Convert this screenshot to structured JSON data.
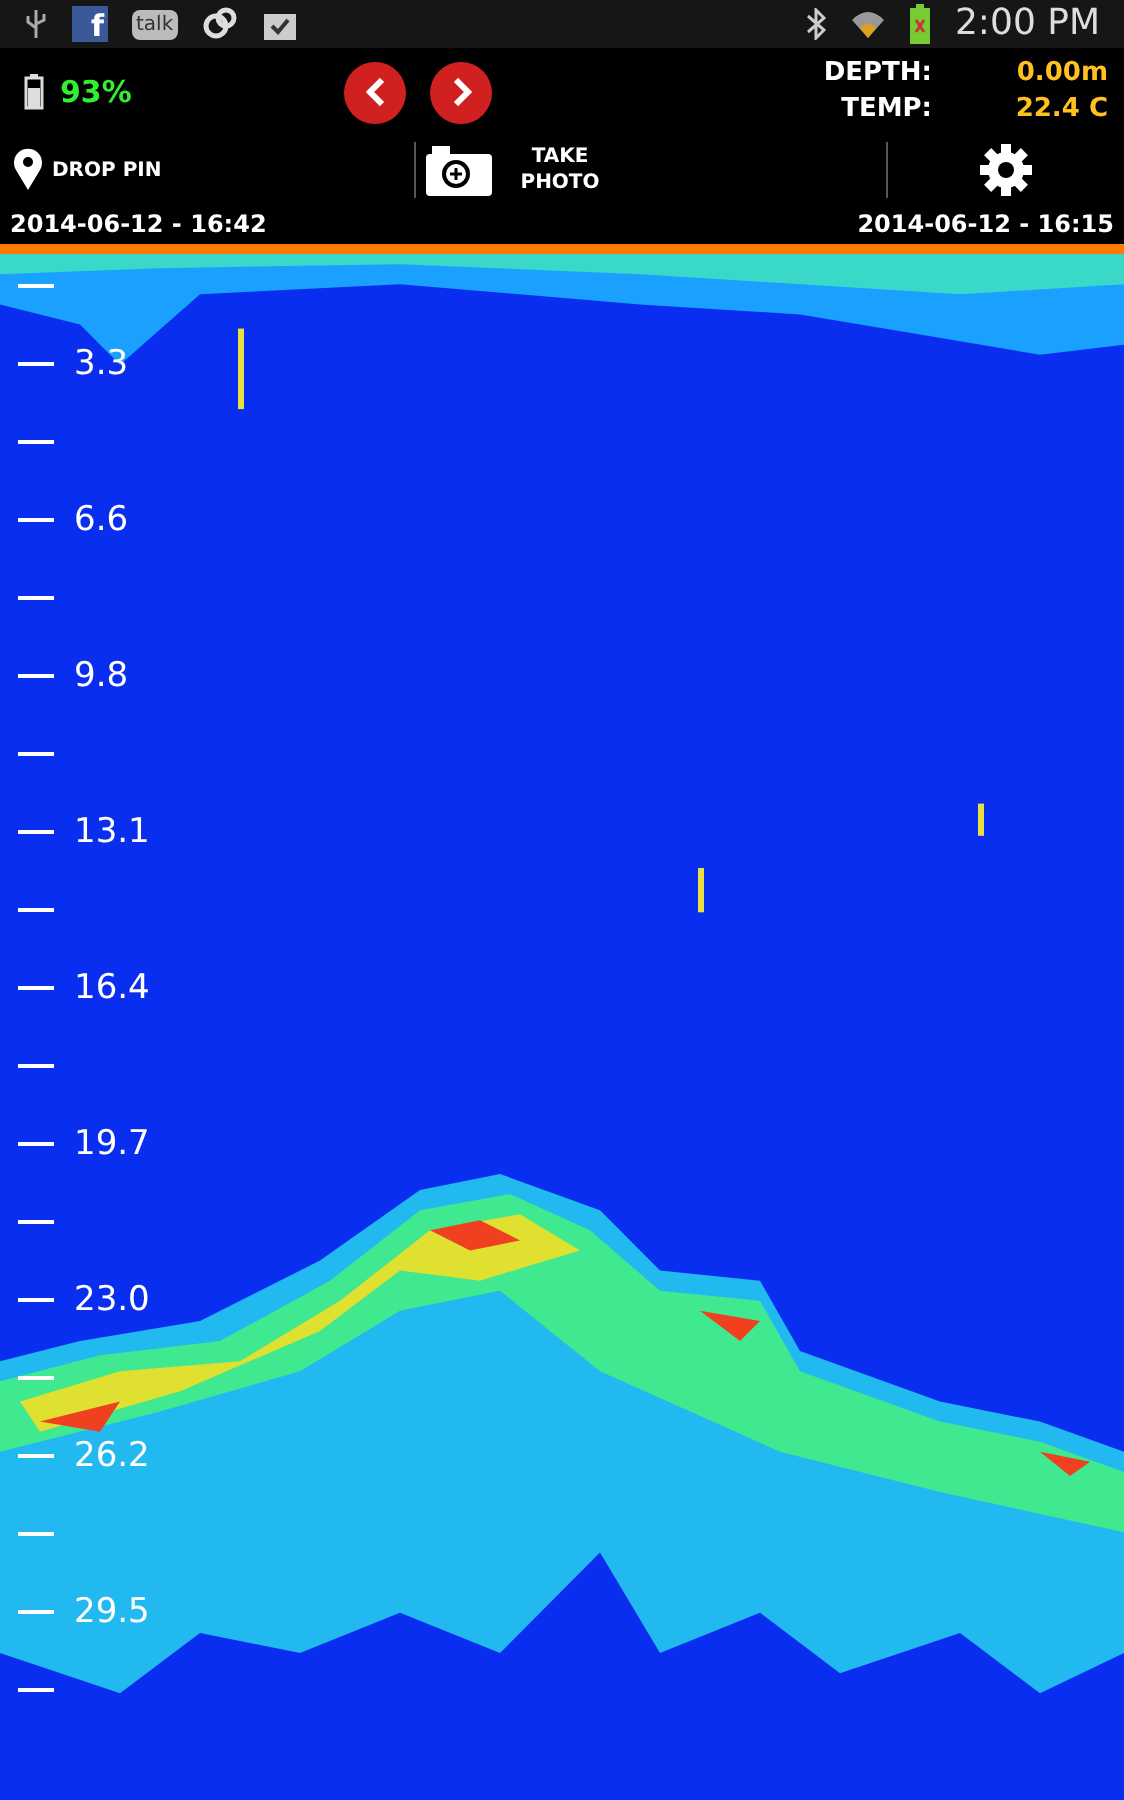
{
  "status_bar": {
    "facebook_label": "f",
    "talk_label": "talk",
    "time": "2:00 PM"
  },
  "header": {
    "battery": "93%",
    "depth_label": "DEPTH:",
    "depth_value": "0.00m",
    "temp_label": "TEMP:",
    "temp_value": "22.4 C"
  },
  "toolbar": {
    "drop_pin": "DROP PIN",
    "take_photo": "TAKE PHOTO"
  },
  "timestamps": {
    "left": "2014-06-12 - 16:42",
    "right": "2014-06-12 - 16:15"
  },
  "depth_scale": [
    "3.3",
    "6.6",
    "9.8",
    "13.1",
    "16.4",
    "19.7",
    "23.0",
    "26.2",
    "29.5"
  ]
}
